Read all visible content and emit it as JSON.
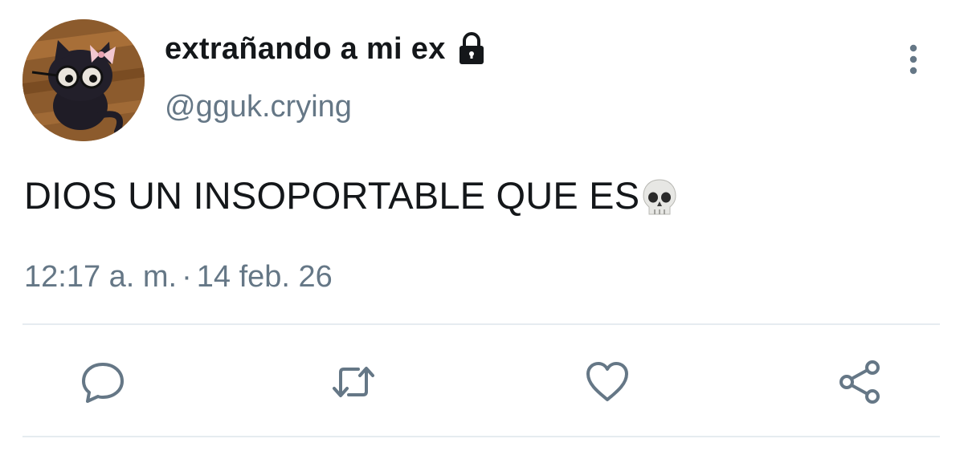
{
  "user": {
    "display_name": "extrañando a mi ex",
    "handle": "@gguk.crying",
    "protected_icon": "lock-icon"
  },
  "tweet": {
    "text": "DIOS UN INSOPORTABLE QUE ES",
    "emoji": "skull-emoji",
    "time": "12:17 a. m.",
    "separator": "·",
    "date": "14 feb. 26"
  },
  "actions": [
    "reply-icon",
    "retweet-icon",
    "like-icon",
    "share-icon"
  ],
  "colors": {
    "text": "#14171a",
    "secondary": "#657786",
    "divider": "#e6ecf0"
  }
}
